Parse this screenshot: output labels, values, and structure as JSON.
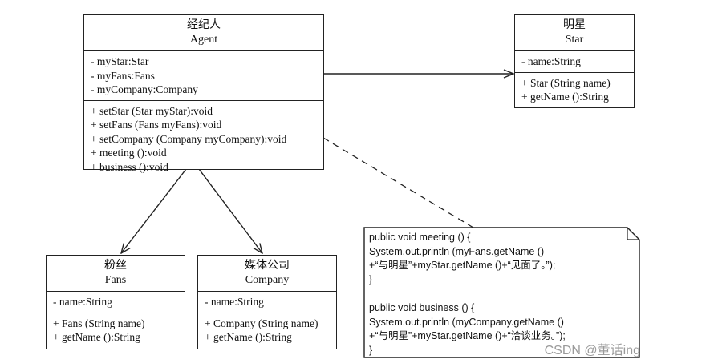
{
  "agent": {
    "title_cn": "经纪人",
    "title_en": "Agent",
    "attributes": [
      "- myStar:Star",
      "- myFans:Fans",
      "- myCompany:Company"
    ],
    "methods": [
      "+ setStar (Star myStar):void",
      "+ setFans (Fans myFans):void",
      "+ setCompany (Company myCompany):void",
      "+ meeting ():void",
      "+ business ():void"
    ]
  },
  "star": {
    "title_cn": "明星",
    "title_en": "Star",
    "attributes": [
      "- name:String"
    ],
    "methods": [
      "+ Star (String name)",
      "+ getName ():String"
    ]
  },
  "fans": {
    "title_cn": "粉丝",
    "title_en": "Fans",
    "attributes": [
      "- name:String"
    ],
    "methods": [
      "+ Fans (String name)",
      "+ getName ():String"
    ]
  },
  "company": {
    "title_cn": "媒体公司",
    "title_en": "Company",
    "attributes": [
      "- name:String"
    ],
    "methods": [
      "+ Company (String name)",
      "+ getName ():String"
    ]
  },
  "note": {
    "lines": [
      "public void meeting () {",
      "   System.out.println (myFans.getName ()",
      "      +“与明星”+myStar.getName ()+“见面了。”);",
      "}",
      "",
      "public void business () {",
      "   System.out.println (myCompany.getName ()",
      "      +“与明星”+myStar.getName ()+“洽谈业务。”);",
      "}"
    ]
  },
  "watermark": "CSDN @董话ing"
}
